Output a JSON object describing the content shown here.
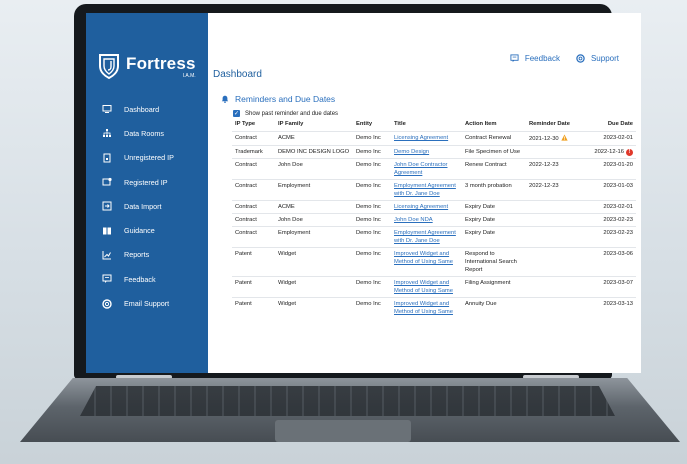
{
  "brand": {
    "name": "Fortress",
    "sub": "I.A.M."
  },
  "nav": [
    {
      "label": "Dashboard",
      "icon": "monitor-icon"
    },
    {
      "label": "Data Rooms",
      "icon": "org-chart-icon"
    },
    {
      "label": "Unregistered IP",
      "icon": "document-lock-icon"
    },
    {
      "label": "Registered IP",
      "icon": "registered-icon"
    },
    {
      "label": "Data Import",
      "icon": "import-icon"
    },
    {
      "label": "Guidance",
      "icon": "book-icon"
    },
    {
      "label": "Reports",
      "icon": "chart-icon"
    },
    {
      "label": "Feedback",
      "icon": "feedback-icon"
    },
    {
      "label": "Email Support",
      "icon": "lifebuoy-icon"
    }
  ],
  "topbar": {
    "feedback": "Feedback",
    "support": "Support"
  },
  "page_title": "Dashboard",
  "section_title": "Reminders and Due Dates",
  "checkbox_label": "Show past reminder and due dates",
  "table": {
    "headers": [
      "IP Type",
      "IP Family",
      "Entity",
      "Title",
      "Action Item",
      "Reminder Date",
      "Due Date"
    ],
    "rows": [
      [
        "Contract",
        "ACME",
        "Demo Inc",
        "Licensing Agreement",
        "Contract Renewal",
        "2021-12-30",
        "2023-02-01"
      ],
      [
        "Trademark",
        "DEMO INC DESIGN LOGO",
        "Demo Inc",
        "Demo Design",
        "File Specimen of Use",
        "",
        "2022-12-16"
      ],
      [
        "Contract",
        "John Doe",
        "Demo Inc",
        "John Doe Contractor Agreement",
        "Renew Contract",
        "2022-12-23",
        "2023-01-20"
      ],
      [
        "Contract",
        "Employment",
        "Demo Inc",
        "Employment Agreement with Dr. Jane Doe",
        "3 month probation",
        "2022-12-23",
        "2023-01-03"
      ],
      [
        "Contract",
        "ACME",
        "Demo Inc",
        "Licensing Agreement",
        "Expiry Date",
        "",
        "2023-02-01"
      ],
      [
        "Contract",
        "John Doe",
        "Demo Inc",
        "John Doe NDA",
        "Expiry Date",
        "",
        "2023-02-23"
      ],
      [
        "Contract",
        "Employment",
        "Demo Inc",
        "Employment Agreement with Dr. Jane Doe",
        "Expiry Date",
        "",
        "2023-02-23"
      ],
      [
        "Patent",
        "Widget",
        "Demo Inc",
        "Improved Widget and Method of Using Same",
        "Respond to International Search Report",
        "",
        "2023-03-06"
      ],
      [
        "Patent",
        "Widget",
        "Demo Inc",
        "Improved Widget and Method of Using Same",
        "Filing Assignment",
        "",
        "2023-03-07"
      ],
      [
        "Patent",
        "Widget",
        "Demo Inc",
        "Improved Widget and Method of Using Same",
        "Annuity Due",
        "",
        "2023-03-13"
      ]
    ]
  },
  "alert_glyph": "!",
  "colors": {
    "sidebar": "#1f5f9e",
    "accent": "#2a6fbd",
    "warning": "#f0a020",
    "alert": "#e0392b"
  }
}
